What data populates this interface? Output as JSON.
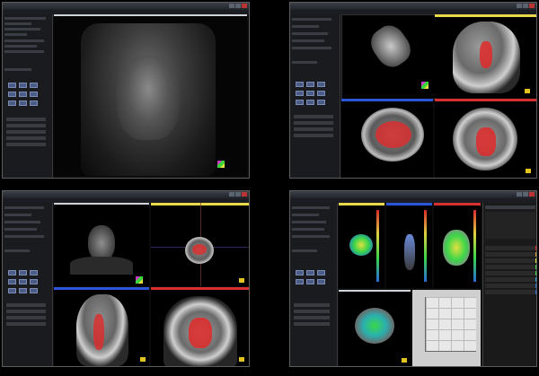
{
  "colors": {
    "view_header_yellow": "#e8d84a",
    "view_header_blue": "#2b56d8",
    "view_header_red": "#d83030",
    "dose_red": "#e02a2a",
    "dose_green": "#3ad64a"
  },
  "windows": [
    {
      "id": "top-left",
      "views": [
        "3d-render"
      ]
    },
    {
      "id": "top-right",
      "views": [
        "3d-render",
        "sagittal",
        "axial",
        "coronal"
      ]
    },
    {
      "id": "bottom-left",
      "views": [
        "3d-thumb",
        "axial",
        "sagittal",
        "coronal"
      ]
    },
    {
      "id": "bottom-right",
      "views": [
        "dose-3d-a",
        "dose-3d-b",
        "dose-3d-c",
        "dose-axial",
        "dvh-plot",
        "dvh-table"
      ]
    }
  ]
}
